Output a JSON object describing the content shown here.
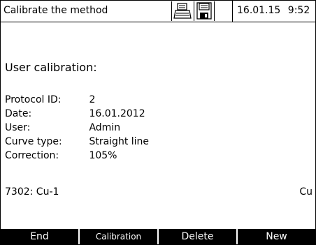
{
  "header": {
    "title": "Calibrate the method",
    "date": "16.01.15",
    "time": "9:52"
  },
  "main": {
    "heading": "User calibration:",
    "fields": [
      {
        "label": "Protocol ID:",
        "value": "2"
      },
      {
        "label": "Date:",
        "value": "16.01.2012"
      },
      {
        "label": "User:",
        "value": "Admin"
      },
      {
        "label": "Curve type:",
        "value": "Straight line"
      },
      {
        "label": "Correction:",
        "value": "105%"
      }
    ],
    "method": "7302: Cu-1",
    "unit": "Cu"
  },
  "softkeys": [
    {
      "label": "End"
    },
    {
      "label": "Calibration"
    },
    {
      "label": "Delete"
    },
    {
      "label": "New"
    }
  ],
  "icons": [
    "printer-icon",
    "save-icon"
  ]
}
